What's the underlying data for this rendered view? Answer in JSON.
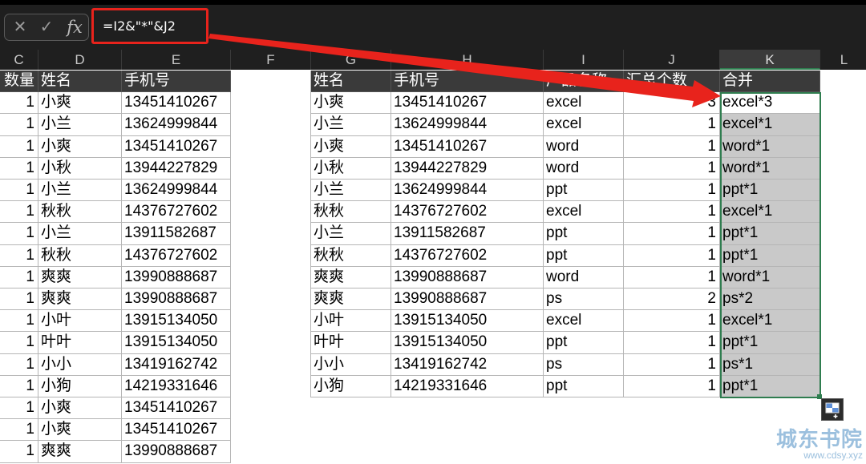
{
  "formula_bar": {
    "formula": "=I2&\"*\"&J2",
    "cancel_symbol": "✕",
    "enter_symbol": "✓",
    "fx_label": "fx"
  },
  "columns": [
    "C",
    "D",
    "E",
    "F",
    "G",
    "H",
    "I",
    "J",
    "K",
    "L"
  ],
  "left_table": {
    "headers": [
      "数量",
      "姓名",
      "手机号"
    ],
    "rows": [
      [
        "1",
        "小爽",
        "13451410267"
      ],
      [
        "1",
        "小兰",
        "13624999844"
      ],
      [
        "1",
        "小爽",
        "13451410267"
      ],
      [
        "1",
        "小秋",
        "13944227829"
      ],
      [
        "1",
        "小兰",
        "13624999844"
      ],
      [
        "1",
        "秋秋",
        "14376727602"
      ],
      [
        "1",
        "小兰",
        "13911582687"
      ],
      [
        "1",
        "秋秋",
        "14376727602"
      ],
      [
        "1",
        "爽爽",
        "13990888687"
      ],
      [
        "1",
        "爽爽",
        "13990888687"
      ],
      [
        "1",
        "小叶",
        "13915134050"
      ],
      [
        "1",
        "叶叶",
        "13915134050"
      ],
      [
        "1",
        "小小",
        "13419162742"
      ],
      [
        "1",
        "小狗",
        "14219331646"
      ],
      [
        "1",
        "小爽",
        "13451410267"
      ],
      [
        "1",
        "小爽",
        "13451410267"
      ],
      [
        "1",
        "爽爽",
        "13990888687"
      ]
    ]
  },
  "right_table": {
    "headers": [
      "姓名",
      "手机号",
      "产品名称",
      "汇总个数",
      "合并"
    ],
    "rows": [
      [
        "小爽",
        "13451410267",
        "excel",
        "3",
        "excel*3"
      ],
      [
        "小兰",
        "13624999844",
        "excel",
        "1",
        "excel*1"
      ],
      [
        "小爽",
        "13451410267",
        "word",
        "1",
        "word*1"
      ],
      [
        "小秋",
        "13944227829",
        "word",
        "1",
        "word*1"
      ],
      [
        "小兰",
        "13624999844",
        "ppt",
        "1",
        "ppt*1"
      ],
      [
        "秋秋",
        "14376727602",
        "excel",
        "1",
        "excel*1"
      ],
      [
        "小兰",
        "13911582687",
        "ppt",
        "1",
        "ppt*1"
      ],
      [
        "秋秋",
        "14376727602",
        "ppt",
        "1",
        "ppt*1"
      ],
      [
        "爽爽",
        "13990888687",
        "word",
        "1",
        "word*1"
      ],
      [
        "爽爽",
        "13990888687",
        "ps",
        "2",
        "ps*2"
      ],
      [
        "小叶",
        "13915134050",
        "excel",
        "1",
        "excel*1"
      ],
      [
        "叶叶",
        "13915134050",
        "ppt",
        "1",
        "ppt*1"
      ],
      [
        "小小",
        "13419162742",
        "ps",
        "1",
        "ps*1"
      ],
      [
        "小狗",
        "14219331646",
        "ppt",
        "1",
        "ppt*1"
      ]
    ]
  },
  "watermark": {
    "title": "城东书院",
    "url": "www.cdsy.xyz"
  },
  "colors": {
    "annotation_red": "#e8231c",
    "selection_green": "#2f7d4f",
    "header_dark": "#3a3a3a",
    "filled_cell_gray": "#c9c9c9"
  }
}
